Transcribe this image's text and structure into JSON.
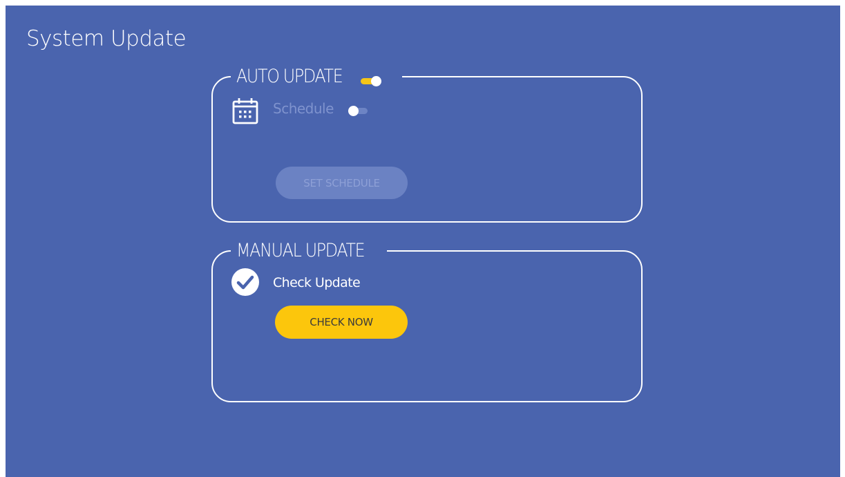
{
  "page": {
    "title": "System Update"
  },
  "auto_update": {
    "legend": "AUTO UPDATE",
    "toggle_on": true,
    "schedule_label": "Schedule",
    "schedule_toggle_on": false,
    "set_schedule_label": "SET SCHEDULE"
  },
  "manual_update": {
    "legend": "MANUAL UPDATE",
    "check_label": "Check Update",
    "check_now_label": "CHECK NOW"
  },
  "colors": {
    "background": "#4a64ae",
    "accent": "#fcc60c",
    "disabled_button": "#6b82c3"
  },
  "icons": {
    "schedule": "calendar-icon",
    "check": "check-circle-icon"
  }
}
